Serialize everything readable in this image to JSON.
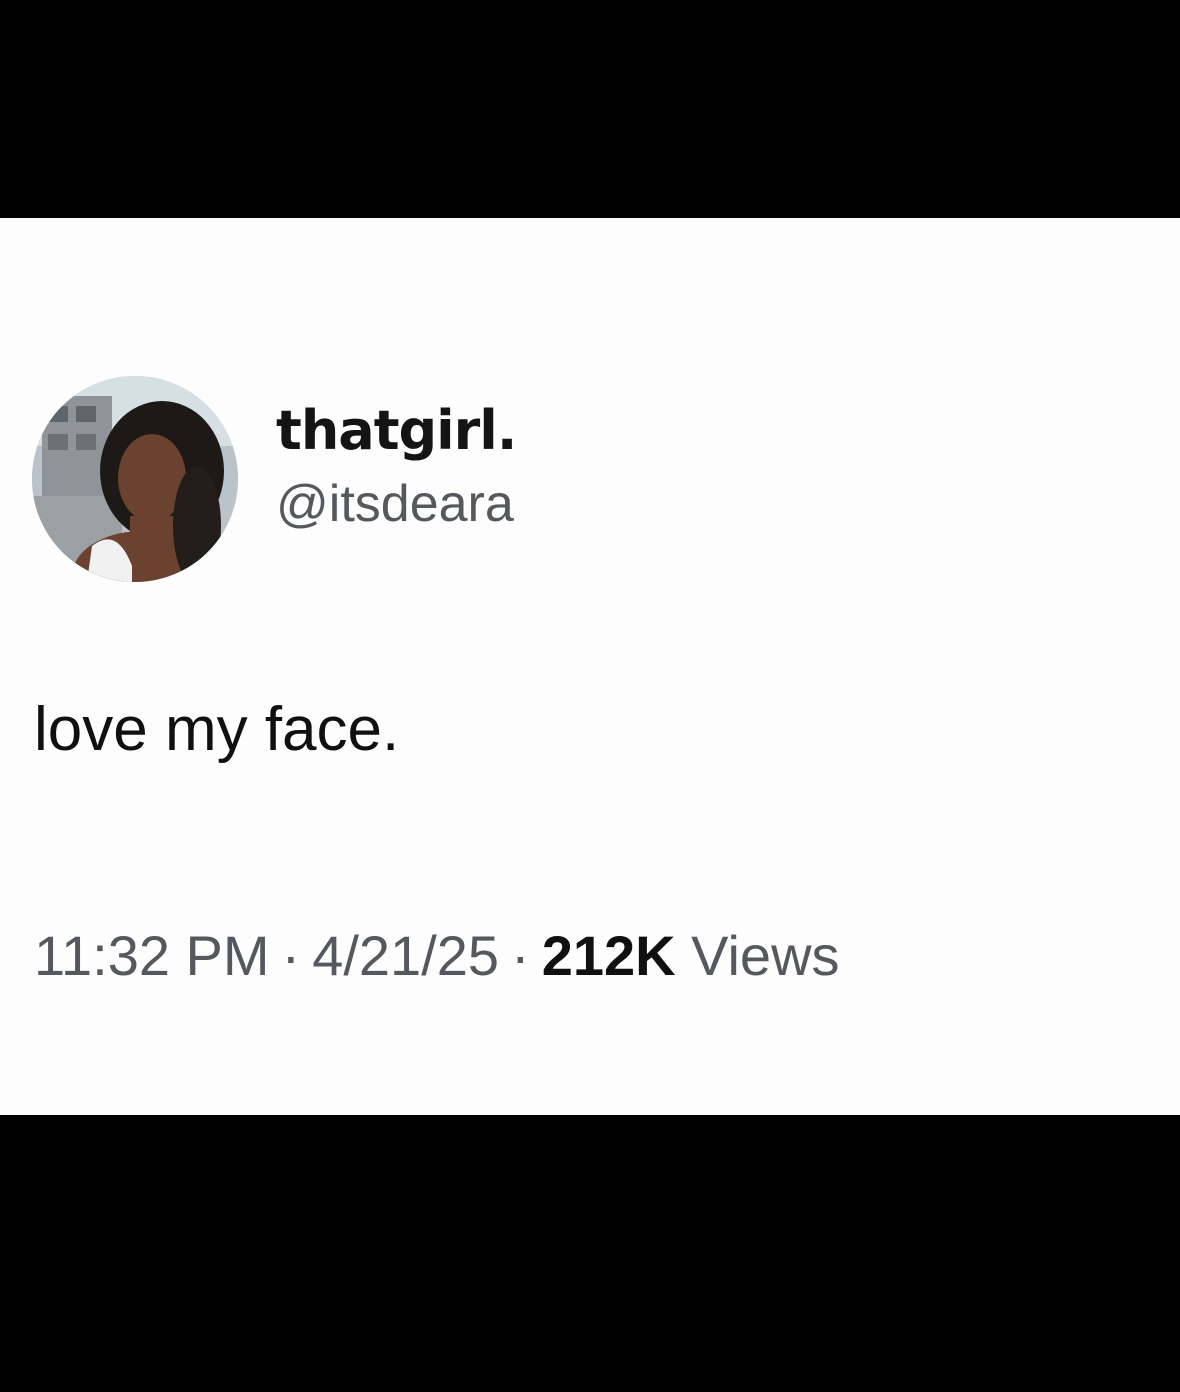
{
  "tweet": {
    "author": {
      "display_name": "thatgirl.",
      "handle": "@itsdeara",
      "avatar_icon": "profile-photo"
    },
    "text": "love my face.",
    "meta": {
      "time": "11:32 PM",
      "separator": "·",
      "date": "4/21/25",
      "views_count": "212K",
      "views_label": "Views"
    }
  },
  "colors": {
    "background": "#000000",
    "card": "#fdfdfd",
    "primary_text": "#101010",
    "secondary_text": "#55595e"
  }
}
